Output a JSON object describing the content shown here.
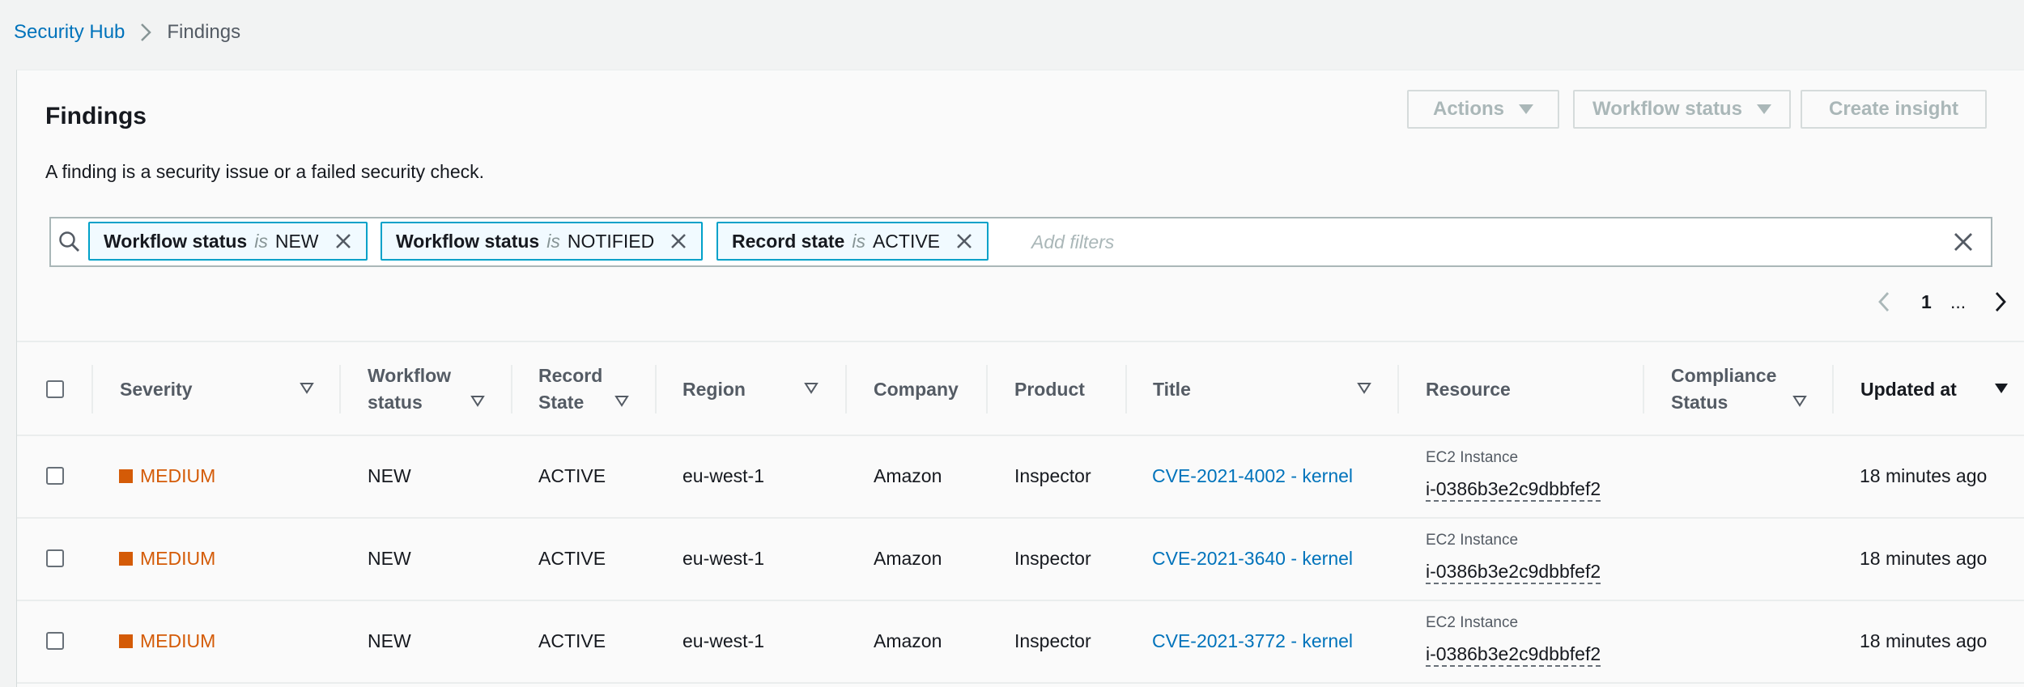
{
  "breadcrumb": {
    "parent": "Security Hub",
    "current": "Findings"
  },
  "panel": {
    "title": "Findings",
    "description": "A finding is a security issue or a failed security check.",
    "buttons": {
      "actions": "Actions",
      "workflow_status": "Workflow status",
      "create_insight": "Create insight"
    }
  },
  "filters": {
    "tokens": [
      {
        "key": "Workflow status",
        "op": "is",
        "value": "NEW"
      },
      {
        "key": "Workflow status",
        "op": "is",
        "value": "NOTIFIED"
      },
      {
        "key": "Record state",
        "op": "is",
        "value": "ACTIVE"
      }
    ],
    "placeholder": "Add filters"
  },
  "pagination": {
    "current_page": "1",
    "ellipsis": "..."
  },
  "table": {
    "columns": {
      "severity": "Severity",
      "workflow_status_line1": "Workflow",
      "workflow_status_line2": "status",
      "record_state_line1": "Record",
      "record_state_line2": "State",
      "region": "Region",
      "company": "Company",
      "product": "Product",
      "title": "Title",
      "resource": "Resource",
      "compliance_line1": "Compliance",
      "compliance_line2": "Status",
      "updated_at": "Updated at"
    },
    "rows": [
      {
        "severity": "MEDIUM",
        "workflow_status": "NEW",
        "record_state": "ACTIVE",
        "region": "eu-west-1",
        "company": "Amazon",
        "product": "Inspector",
        "title": "CVE-2021-4002 - kernel",
        "resource_type": "EC2 Instance",
        "resource_id": "i-0386b3e2c9dbbfef2",
        "compliance_status": "",
        "updated_at": "18 minutes ago"
      },
      {
        "severity": "MEDIUM",
        "workflow_status": "NEW",
        "record_state": "ACTIVE",
        "region": "eu-west-1",
        "company": "Amazon",
        "product": "Inspector",
        "title": "CVE-2021-3640 - kernel",
        "resource_type": "EC2 Instance",
        "resource_id": "i-0386b3e2c9dbbfef2",
        "compliance_status": "",
        "updated_at": "18 minutes ago"
      },
      {
        "severity": "MEDIUM",
        "workflow_status": "NEW",
        "record_state": "ACTIVE",
        "region": "eu-west-1",
        "company": "Amazon",
        "product": "Inspector",
        "title": "CVE-2021-3772 - kernel",
        "resource_type": "EC2 Instance",
        "resource_id": "i-0386b3e2c9dbbfef2",
        "compliance_status": "",
        "updated_at": "18 minutes ago"
      }
    ]
  },
  "colors": {
    "link": "#0073bb",
    "medium_severity": "#d45b07",
    "token_border": "#00a1c9"
  },
  "icons": {
    "search": "search-icon",
    "close": "close-icon",
    "chevron_right": "chevron-right-icon",
    "chevron_left": "chevron-left-icon",
    "sort": "sort-caret-icon"
  }
}
